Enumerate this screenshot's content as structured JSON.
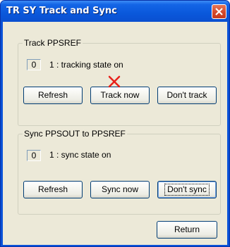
{
  "window": {
    "title": "TR SY Track and Sync"
  },
  "track_group": {
    "label": "Track PPSREF",
    "state_value": "0",
    "state_text": "1 : tracking state on",
    "refresh_label": "Refresh",
    "track_now_label": "Track now",
    "dont_track_label": "Don't track"
  },
  "sync_group": {
    "label": "Sync PPSOUT to PPSREF",
    "state_value": "0",
    "state_text": "1 : sync state on",
    "refresh_label": "Refresh",
    "sync_now_label": "Sync now",
    "dont_sync_label": "Don't sync"
  },
  "footer": {
    "return_label": "Return"
  },
  "colors": {
    "titlebar": "#0a58db",
    "face": "#ece9d8",
    "marker": "#e8221b",
    "close_button": "#d4492c"
  }
}
